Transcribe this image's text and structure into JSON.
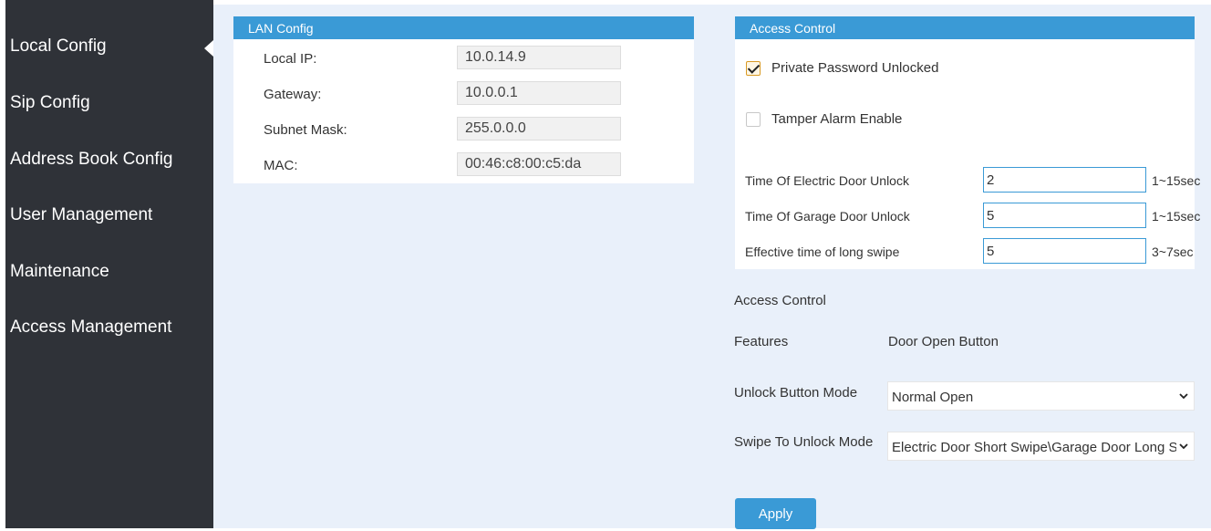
{
  "sidebar": {
    "items": [
      {
        "label": "Local Config"
      },
      {
        "label": "Sip Config"
      },
      {
        "label": "Address Book Config"
      },
      {
        "label": "User Management"
      },
      {
        "label": "Maintenance"
      },
      {
        "label": "Access Management"
      }
    ]
  },
  "lan": {
    "title": "LAN Config",
    "local_ip_label": "Local IP:",
    "local_ip": "10.0.14.9",
    "gateway_label": "Gateway:",
    "gateway": "10.0.0.1",
    "subnet_label": "Subnet Mask:",
    "subnet": "255.0.0.0",
    "mac_label": "MAC:",
    "mac": "00:46:c8:00:c5:da"
  },
  "access": {
    "title": "Access Control",
    "private_password_label": "Private Password Unlocked",
    "private_password_checked": true,
    "tamper_label": "Tamper Alarm Enable",
    "tamper_checked": false,
    "electric_label": "Time Of Electric Door Unlock",
    "electric_value": "2",
    "electric_unit": "1~15sec",
    "garage_label": "Time Of Garage Door Unlock",
    "garage_value": "5",
    "garage_unit": "1~15sec",
    "swipe_label": "Effective time of long swipe",
    "swipe_value": "5",
    "swipe_unit": "3~7sec"
  },
  "access_control": {
    "section_label": "Access Control",
    "features_label": "Features",
    "features_value": "Door Open Button",
    "unlock_mode_label": "Unlock Button Mode",
    "unlock_mode_value": "Normal Open",
    "swipe_mode_label": "Swipe To Unlock Mode",
    "swipe_mode_value": "Electric Door Short Swipe\\Garage Door Long Swipe",
    "apply_label": "Apply"
  },
  "colors": {
    "sidebar_bg": "#2f3238",
    "accent": "#3a9ad6",
    "main_bg": "#e9f0fa"
  }
}
